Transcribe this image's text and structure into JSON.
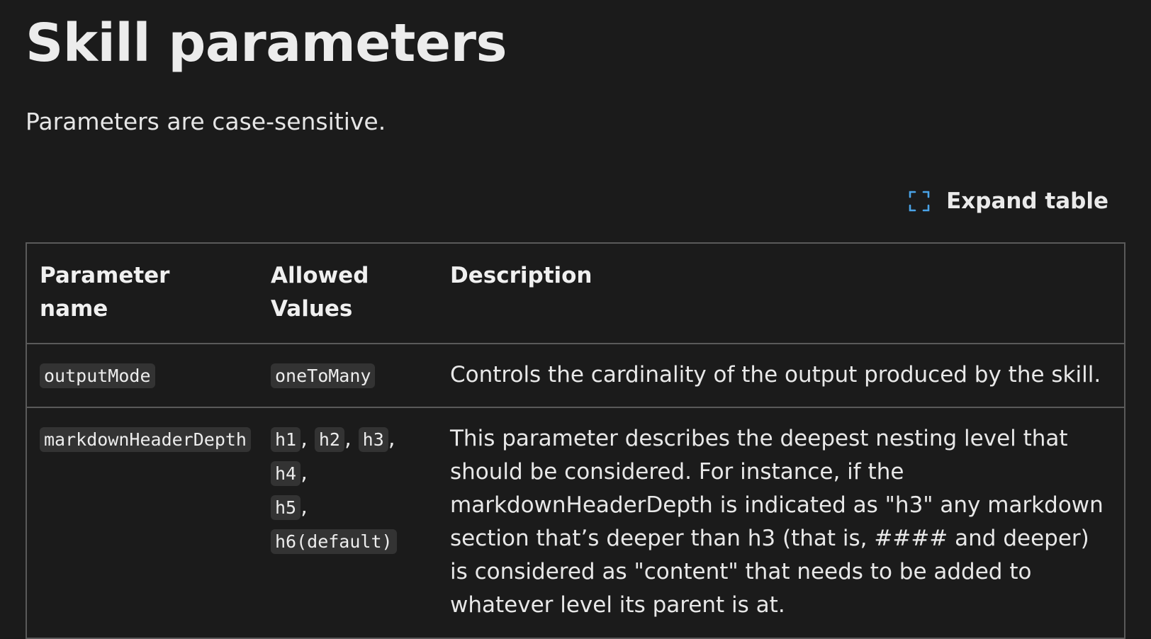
{
  "heading": "Skill parameters",
  "subtitle": "Parameters are case-sensitive.",
  "expand_table": {
    "label": "Expand table",
    "icon": "expand-icon"
  },
  "table": {
    "headers": [
      "Parameter name",
      "Allowed Values",
      "Description"
    ],
    "rows": [
      {
        "name": "outputMode",
        "values": [
          "oneToMany"
        ],
        "description": "Controls the cardinality of the output produced by the skill."
      },
      {
        "name": "markdownHeaderDepth",
        "values": [
          "h1",
          "h2",
          "h3",
          "h4",
          "h5",
          "h6(default)"
        ],
        "separators": [
          ",",
          ","
        ],
        "description": "This parameter describes the deepest nesting level that should be considered. For instance, if the markdownHeaderDepth is indicated as \"h3\" any markdown section that’s deeper than h3 (that is, #### and deeper) is considered as \"content\" that needs to be added to whatever level its parent is at."
      }
    ]
  },
  "colors": {
    "background": "#1b1b1b",
    "code_background": "#333333",
    "border": "#5a5a5a",
    "icon_accent": "#4aa3e8"
  }
}
